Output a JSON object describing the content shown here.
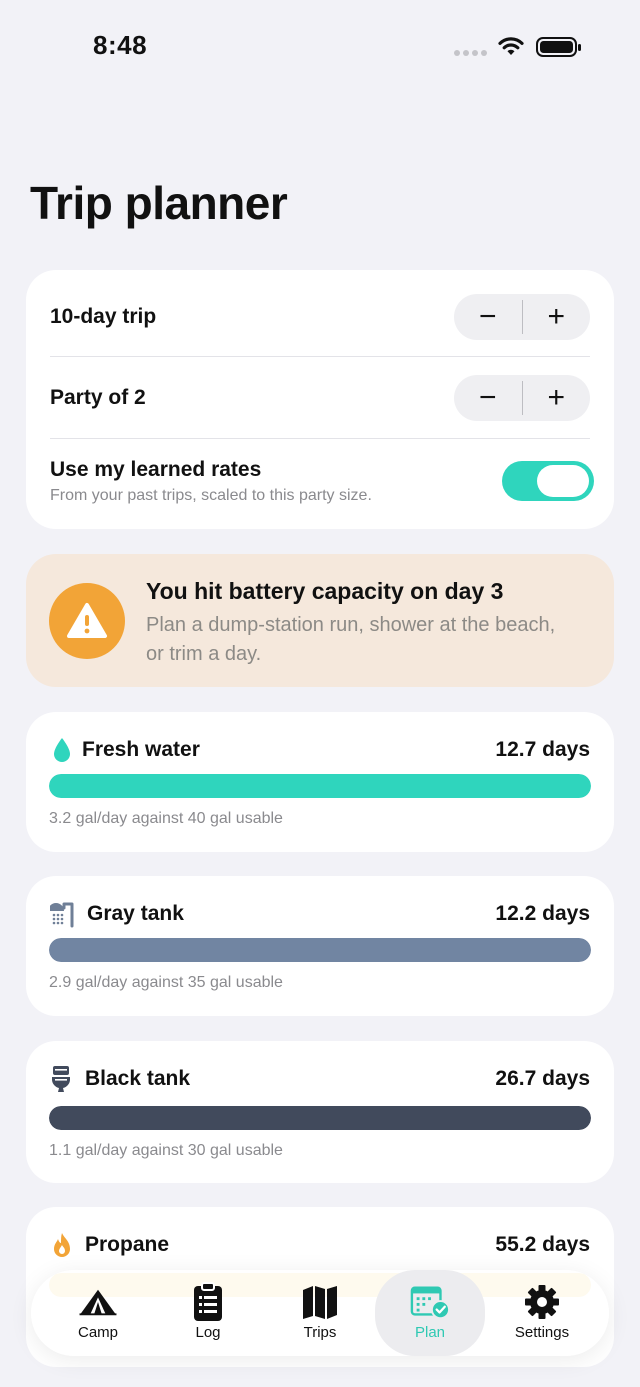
{
  "status_bar": {
    "time": "8:48"
  },
  "page_title": "Trip planner",
  "settings": {
    "trip_label": "10-day trip",
    "party_label": "Party of 2",
    "stepper_minus": "−",
    "stepper_plus": "+",
    "learned_rates_label": "Use my learned rates",
    "learned_rates_sub": "From your past trips, scaled to this party size.",
    "learned_rates_on": true
  },
  "alert": {
    "title": "You hit battery capacity on day 3",
    "body": "Plan a dump-station run, shower at the beach, or trim a day.",
    "icon": "warning-triangle-icon",
    "color": "#f2a437"
  },
  "resources": [
    {
      "name": "Fresh water",
      "days": "12.7 days",
      "detail": "3.2 gal/day against 40 gal usable",
      "fill": 1.0,
      "color": "#2fd5bd",
      "icon": "water-drop-icon"
    },
    {
      "name": "Gray tank",
      "days": "12.2 days",
      "detail": "2.9 gal/day against 35 gal usable",
      "fill": 1.0,
      "color": "#7185a2",
      "icon": "shower-icon"
    },
    {
      "name": "Black tank",
      "days": "26.7 days",
      "detail": "1.1 gal/day against 30 gal usable",
      "fill": 1.0,
      "color": "#414a5c",
      "icon": "toilet-icon"
    },
    {
      "name": "Propane",
      "days": "55.2 days",
      "detail": "",
      "fill": 1.0,
      "color": "#f7dc8a",
      "icon": "flame-icon"
    }
  ],
  "tabs": [
    {
      "label": "Camp",
      "icon": "tent-icon",
      "active": false
    },
    {
      "label": "Log",
      "icon": "clipboard-icon",
      "active": false
    },
    {
      "label": "Trips",
      "icon": "map-icon",
      "active": false
    },
    {
      "label": "Plan",
      "icon": "calendar-check-icon",
      "active": true
    },
    {
      "label": "Settings",
      "icon": "gear-icon",
      "active": false
    }
  ],
  "accent_color": "#2fd5bd"
}
